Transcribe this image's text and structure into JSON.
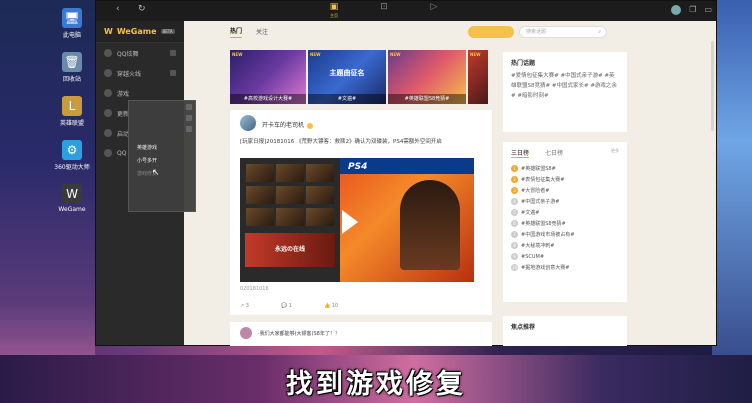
{
  "desktop": {
    "icons": [
      {
        "name": "desktop-computer",
        "label": "此电脑",
        "glyph": "🖥",
        "color": "#3a7ad0"
      },
      {
        "name": "recycle-bin",
        "label": "回收站",
        "glyph": "🗑",
        "color": "#6a8aaa"
      },
      {
        "name": "league",
        "label": "英雄联盟",
        "glyph": "L",
        "color": "#c89b3c"
      },
      {
        "name": "360-driver",
        "label": "360驱动大师",
        "glyph": "⚙",
        "color": "#2aa0e0"
      },
      {
        "name": "wegame",
        "label": "WeGame",
        "glyph": "W",
        "color": "#3a3a3a"
      }
    ]
  },
  "titlebar": {
    "tabs": [
      {
        "label": "主页",
        "icon": "home",
        "active": true
      },
      {
        "label": "",
        "icon": "store",
        "active": false
      },
      {
        "label": "",
        "icon": "video",
        "active": false
      }
    ]
  },
  "sidebar": {
    "brand": "WeGame",
    "brand_badge": "BETA",
    "items": [
      "QQ炫舞",
      "穿越火线",
      "游戏",
      "更新",
      "启动",
      "QQ"
    ]
  },
  "context_menu": {
    "items": [
      {
        "label": "",
        "on": false
      },
      {
        "label": "",
        "on": false
      },
      {
        "label": "",
        "on": false
      },
      {
        "label": "英雄游戏",
        "on": true
      },
      {
        "label": "小号多开",
        "on": true
      },
      {
        "label": "游戏修复",
        "on": false
      },
      {
        "label": "",
        "on": false
      },
      {
        "label": "",
        "on": false
      }
    ]
  },
  "topnav": {
    "tabs": [
      "热门",
      "关注"
    ],
    "pill": "",
    "search_placeholder": "搜索话题"
  },
  "banners": [
    {
      "new": "NEW",
      "caption": "#高校游戏设计大赛#",
      "mid": "",
      "bg": "linear-gradient(135deg,#2a1f6a,#6a3aa0,#e07ad0)"
    },
    {
      "new": "NEW",
      "caption": "#文遍#",
      "mid": "主题曲征名",
      "bg": "linear-gradient(135deg,#1a3a8a,#3a6ad0,#1a2a6a)"
    },
    {
      "new": "NEW",
      "caption": "#英雄联盟S8竞猜#",
      "mid": "",
      "bg": "linear-gradient(135deg,#6a3a8a,#e05a6a,#f5c14a)"
    },
    {
      "new": "NEW",
      "caption": "",
      "mid": "",
      "bg": "linear-gradient(135deg,#c23a2a,#4a1a1a)"
    }
  ],
  "post": {
    "author": "开卡车的老司机",
    "text": "[玩家日报]20181016 《荒野大镖客：救赎2》确认为双碟装，PS4需额外空间开启",
    "img_left_label": "永远の在线",
    "ps4_label": "PS4",
    "date": "02018101​6",
    "actions": [
      "3",
      "1",
      "10"
    ]
  },
  "post2": {
    "text": "·我们大家都能够(大镖客)S8年了！！"
  },
  "right_panel": {
    "hot_title": "热门话题",
    "hot_tags": "#爱情包征集大赛# #中国式亲子游# #英雄联盟S8竞猜# #中国式家长# #游戏之余# #暗影时刻#",
    "rank_tabs": [
      "三日榜",
      "七日榜"
    ],
    "rank_more": "更多",
    "rank": [
      {
        "n": "1",
        "text": "#英雄联盟S8#",
        "hot": true
      },
      {
        "n": "2",
        "text": "#表情包征集大赛#",
        "hot": true
      },
      {
        "n": "3",
        "text": "#大冒险者#",
        "hot": true
      },
      {
        "n": "4",
        "text": "#中国式亲子游#",
        "hot": false
      },
      {
        "n": "5",
        "text": "#文遍#",
        "hot": false
      },
      {
        "n": "6",
        "text": "#英雄联盟S8竞猜#",
        "hot": false
      },
      {
        "n": "7",
        "text": "#中国游戏市场被占有#",
        "hot": false
      },
      {
        "n": "8",
        "text": "#大秘境冲刺#",
        "hot": false
      },
      {
        "n": "9",
        "text": "#SCUM#",
        "hot": false
      },
      {
        "n": "10",
        "text": "#掘地游戏创意大赛#",
        "hot": false
      }
    ],
    "focus_title": "焦点推荐"
  },
  "subtitle": "找到游戏修复"
}
